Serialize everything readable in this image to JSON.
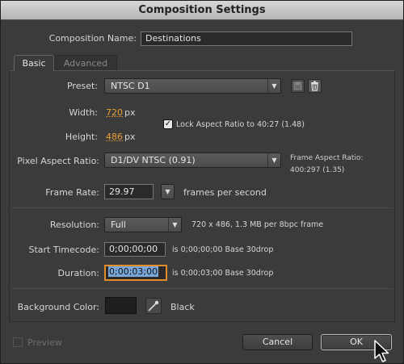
{
  "window": {
    "title": "Composition Settings"
  },
  "composition": {
    "name_label": "Composition Name:",
    "name_value": "Destinations"
  },
  "tabs": [
    {
      "label": "Basic",
      "active": true
    },
    {
      "label": "Advanced",
      "active": false
    }
  ],
  "preset": {
    "label": "Preset:",
    "value": "NTSC D1",
    "save_icon": "disk-icon",
    "delete_icon": "trash-icon"
  },
  "size": {
    "width_label": "Width:",
    "width_value": "720",
    "width_unit": "px",
    "height_label": "Height:",
    "height_value": "486",
    "height_unit": "px",
    "lock_checked": true,
    "lock_label": "Lock Aspect Ratio to 40:27 (1.48)"
  },
  "pixel_aspect": {
    "label": "Pixel Aspect Ratio:",
    "value": "D1/DV NTSC (0.91)",
    "frame_aspect_label": "Frame Aspect Ratio:",
    "frame_aspect_value": "400:297 (1.35)"
  },
  "frame_rate": {
    "label": "Frame Rate:",
    "value": "29.97",
    "unit": "frames per second"
  },
  "resolution": {
    "label": "Resolution:",
    "value": "Full",
    "info": "720 x 486, 1.3 MB per 8bpc frame"
  },
  "start_timecode": {
    "label": "Start Timecode:",
    "value": "0;00;00;00",
    "info": "is 0;00;00;00  Base 30drop"
  },
  "duration": {
    "label": "Duration:",
    "value": "0;00;03;00",
    "info": "is 0;00;03;00  Base 30drop"
  },
  "background": {
    "label": "Background Color:",
    "swatch_color": "#1f1f1f",
    "color_name": "Black"
  },
  "footer": {
    "preview_label": "Preview",
    "cancel_label": "Cancel",
    "ok_label": "OK"
  },
  "colors": {
    "accent_orange": "#e8a135",
    "dialog_bg": "#3b3b3b"
  }
}
